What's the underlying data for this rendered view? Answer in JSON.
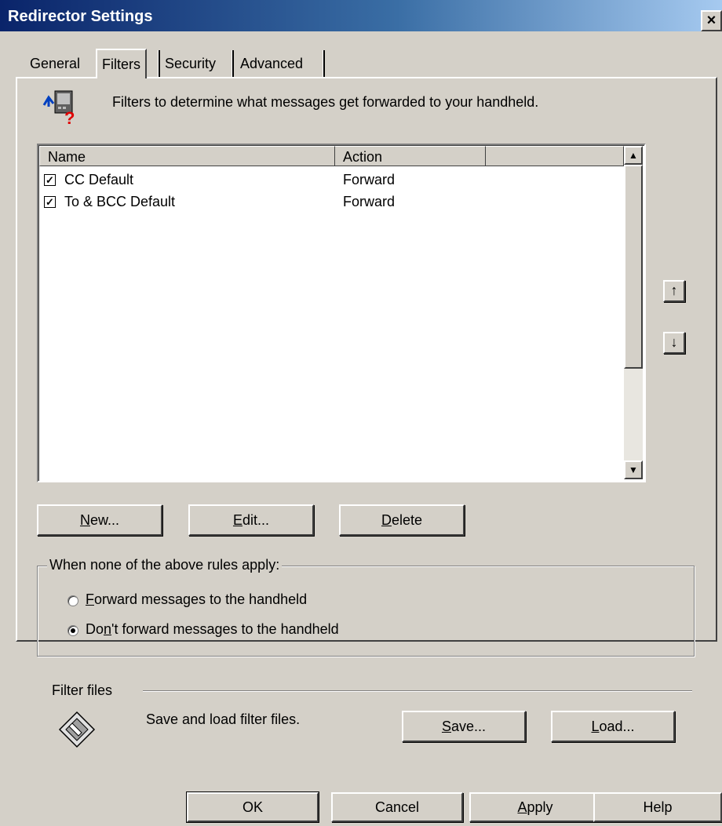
{
  "window": {
    "title": "Redirector Settings",
    "close_label": "×"
  },
  "tabs": [
    {
      "label": "General"
    },
    {
      "label": "Filters"
    },
    {
      "label": "Security"
    },
    {
      "label": "Advanced"
    }
  ],
  "description": "Filters to determine what messages get forwarded to your handheld.",
  "filter_list": {
    "columns": [
      "Name",
      "Action"
    ],
    "rows": [
      {
        "name": "CC Default",
        "action": "Forward",
        "checked": true
      },
      {
        "name": "To & BCC Default",
        "action": "Forward",
        "checked": true
      }
    ]
  },
  "move_buttons": {
    "up": "↑",
    "down": "↓"
  },
  "list_buttons": {
    "new_u": "N",
    "new_rest": "ew...",
    "edit_u": "E",
    "edit_rest": "dit...",
    "delete_u": "D",
    "delete_rest": "elete"
  },
  "rules_group": {
    "legend": "When none of the above rules apply:",
    "forward_u": "F",
    "forward_rest": "orward messages to the handheld",
    "dont_pre": "Do",
    "dont_u": "n",
    "dont_rest": "'t forward messages to the handheld",
    "selected": "dont_forward"
  },
  "filter_files": {
    "heading": "Filter files",
    "text": "Save and load filter files.",
    "save_u": "S",
    "save_rest": "ave...",
    "load_u": "L",
    "load_rest": "oad..."
  },
  "footer": {
    "ok": "OK",
    "cancel": "Cancel",
    "apply_u": "A",
    "apply_rest": "pply",
    "help": "Help"
  }
}
